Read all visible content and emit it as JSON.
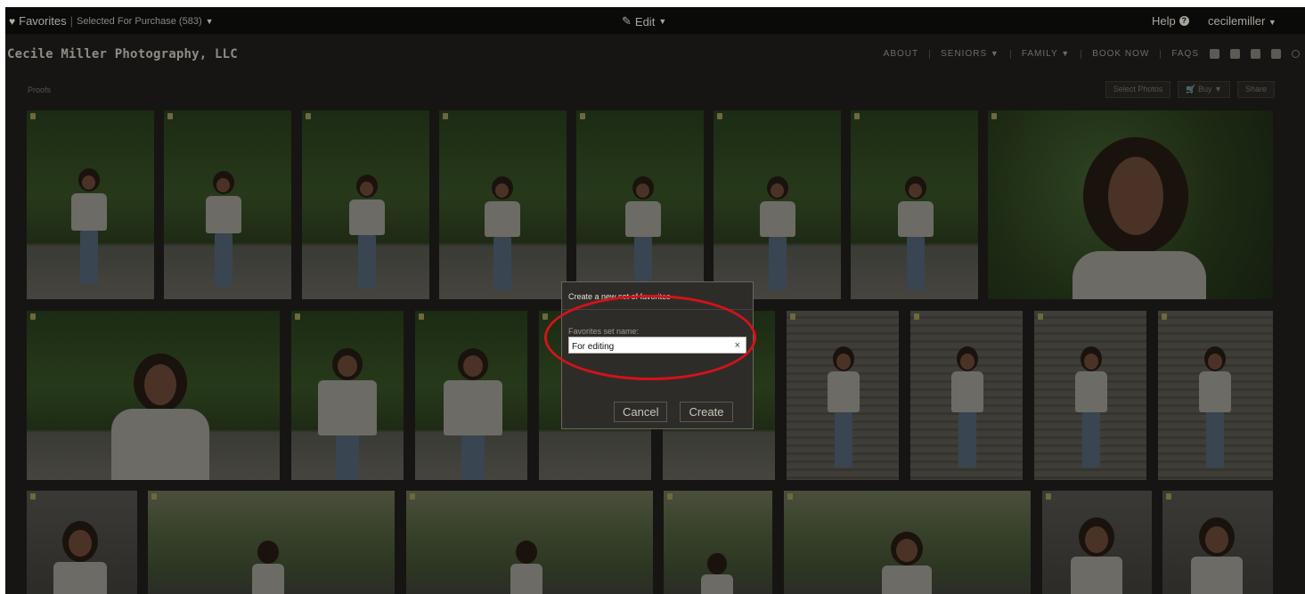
{
  "topbar": {
    "favorites_label": "Favorites",
    "selected_label": "Selected For Purchase (583)",
    "edit_label": "Edit",
    "help_label": "Help",
    "username": "cecilemiller"
  },
  "site": {
    "brand": "Cecile Miller Photography, LLC",
    "nav": [
      "ABOUT",
      "SENIORS",
      "FAMILY",
      "BOOK NOW",
      "FAQS"
    ]
  },
  "gallery": {
    "breadcrumb": "Proofs",
    "select_photos_label": "Select Photos",
    "buy_label": "Buy",
    "share_label": "Share"
  },
  "dialog": {
    "title": "Create a new set of favorites",
    "field_label": "Favorites set name:",
    "field_value": "For editing",
    "clear_glyph": "×",
    "cancel_label": "Cancel",
    "create_label": "Create"
  },
  "colors": {
    "annotation": "#d4121a",
    "overlay": "#161513"
  }
}
